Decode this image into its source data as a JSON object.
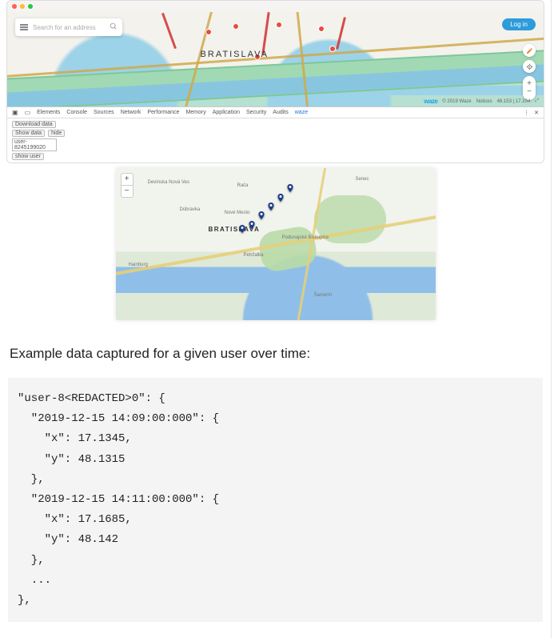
{
  "browser": {
    "search_placeholder": "Search for an address",
    "login_label": "Log in",
    "city_label": "BRATISLAVA",
    "attribution_brand": "waze",
    "attribution_copy": "© 2019 Waze",
    "attribution_notices": "Notices",
    "attribution_coords": "48.153 | 17.104"
  },
  "devtools": {
    "tabs": [
      "Elements",
      "Console",
      "Sources",
      "Network",
      "Performance",
      "Memory",
      "Application",
      "Security",
      "Audits",
      "waze"
    ],
    "selected_tab": "waze",
    "panel": {
      "download_label": "Download data",
      "show_label": "Show data",
      "hide_label": "hide",
      "user_id_value": "user-8245199020",
      "show_user_label": "show user"
    },
    "icons": {
      "errors": "",
      "close": "✕"
    }
  },
  "map2": {
    "city_label": "BRATISLAVA",
    "places": {
      "devinska": "Devínska Nová Ves",
      "dubravka": "Dúbravka",
      "raca": "Rača",
      "novemesto": "Nové Mesto",
      "senec": "Senec",
      "petrzalka": "Petržalka",
      "podbisk": "Podunajské Biskupice",
      "hainburg": "Hainburg",
      "samorin": "Šamorín"
    }
  },
  "article": {
    "caption": "Example data captured for a given user over time:"
  },
  "code_sample": "\"user-8<REDACTED>0\": {\n  \"2019-12-15 14:09:00:000\": {\n    \"x\": 17.1345,\n    \"y\": 48.1315\n  },\n  \"2019-12-15 14:11:00:000\": {\n    \"x\": 17.1685,\n    \"y\": 48.142\n  },\n  ...\n},"
}
